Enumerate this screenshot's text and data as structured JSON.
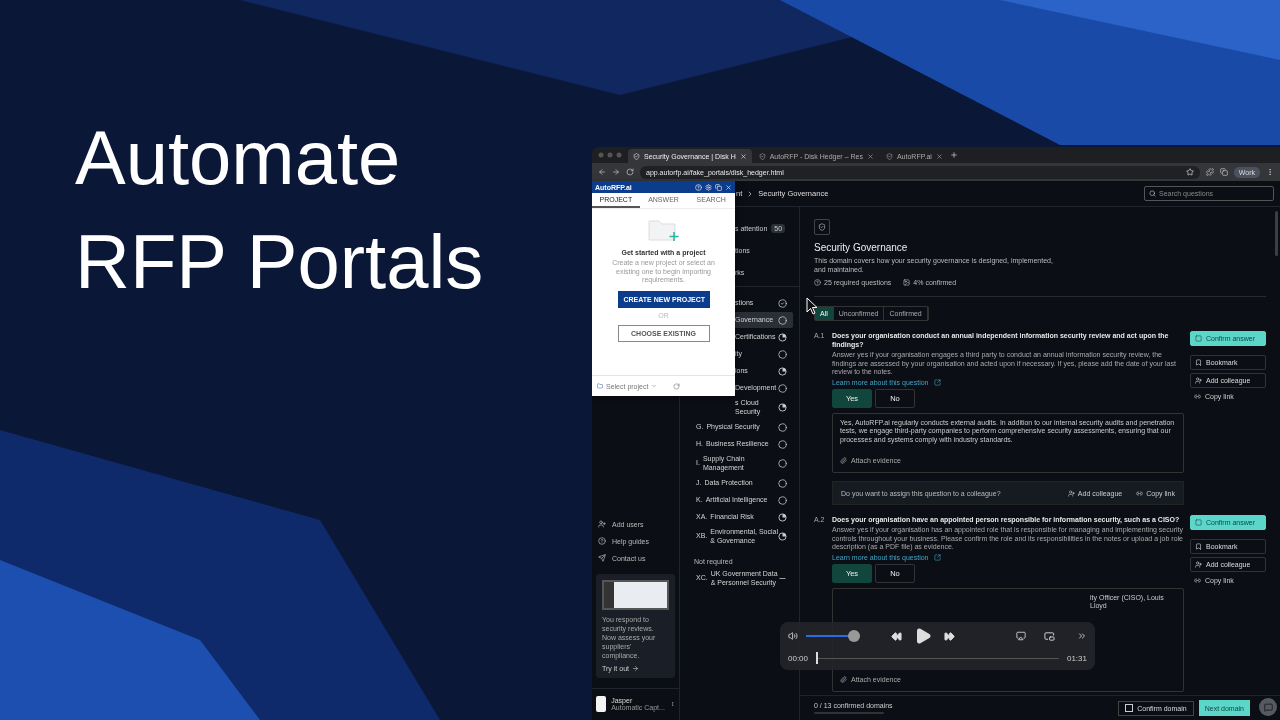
{
  "headline": "Automate RFP Portals",
  "browser": {
    "tabs": [
      {
        "title": "Security Governance | Disk H",
        "selected": true
      },
      {
        "title": "AutoRFP - Disk Hedger – Res",
        "selected": false
      },
      {
        "title": "AutoRFP.ai",
        "selected": false
      }
    ],
    "url": "app.autorfp.ai/fake_portals/disk_hedger.html",
    "profile": "Work"
  },
  "header": {
    "breadcrumb": [
      "nt",
      "Security Governance"
    ],
    "search_placeholder": "Search questions"
  },
  "sidebar": {
    "links": [
      "Add users",
      "Help guides",
      "Contact us"
    ],
    "promo": {
      "text": "You respond to security reviews. Now assess your suppliers' compliance.",
      "link": "Try it out"
    },
    "user": {
      "name": "Jasper",
      "org": "Automatic Capt..."
    }
  },
  "nav": {
    "items": [
      {
        "label": "s attention",
        "badge": "50",
        "covered": true
      },
      {
        "label": "tions",
        "covered": true
      },
      {
        "label": "rks",
        "covered": true
      }
    ],
    "domains": [
      {
        "name": "stions",
        "kind": "done",
        "selected": false,
        "covered": true
      },
      {
        "name": "Governance",
        "kind": "empty",
        "selected": true,
        "covered": true
      },
      {
        "name": "Certifications",
        "kind": "partial",
        "selected": false,
        "covered": true
      },
      {
        "name": "ity",
        "kind": "empty",
        "selected": false,
        "covered": true
      },
      {
        "name": "ions",
        "kind": "partial",
        "selected": false,
        "covered": true
      },
      {
        "name": "Development",
        "kind": "empty",
        "selected": false,
        "covered": true
      },
      {
        "name": "s Cloud Security",
        "kind": "partial",
        "selected": false,
        "covered": true
      },
      {
        "code": "G.",
        "name": "Physical Security",
        "kind": "empty",
        "selected": false
      },
      {
        "code": "H.",
        "name": "Business Resilience",
        "kind": "empty",
        "selected": false
      },
      {
        "code": "I.",
        "name": "Supply Chain Management",
        "kind": "empty",
        "selected": false
      },
      {
        "code": "J.",
        "name": "Data Protection",
        "kind": "empty",
        "selected": false
      },
      {
        "code": "K.",
        "name": "Artificial Intelligence",
        "kind": "empty",
        "selected": false
      },
      {
        "code": "XA.",
        "name": "Financial Risk",
        "kind": "partial",
        "selected": false
      },
      {
        "code": "XB.",
        "name": "Environmental, Social & Governance",
        "kind": "partial",
        "selected": false
      }
    ],
    "not_required_label": "Not required",
    "not_required": [
      {
        "code": "XC.",
        "name": "UK Government Data & Personnel Security",
        "kind": "none",
        "selected": false
      }
    ]
  },
  "popup": {
    "brand": "AutoRFP.ai",
    "tabs": [
      {
        "label": "PROJECT",
        "selected": true
      },
      {
        "label": "ANSWER",
        "selected": false
      },
      {
        "label": "SEARCH",
        "selected": false
      }
    ],
    "heading": "Get started with a project",
    "text": "Create a new project or select an existing one to begin importing requirements.",
    "primary": "CREATE NEW PROJECT",
    "or": "OR",
    "secondary": "CHOOSE EXISTING",
    "select": "Select project"
  },
  "domain": {
    "title": "Security Governance",
    "description": "This domain covers how your security governance is designed, implemented, and maintained.",
    "stats": [
      "25 required questions",
      "4% confirmed"
    ],
    "filters": [
      {
        "label": "All",
        "selected": true
      },
      {
        "label": "Unconfirmed",
        "selected": false
      },
      {
        "label": "Confirmed",
        "selected": false
      }
    ]
  },
  "questions": [
    {
      "number": "A.1",
      "title": "Does your organisation conduct an annual independent information security review and act upon the findings?",
      "help": "Answer yes if your organisation engages a third party to conduct an annual information security review, the findings are assessed by your organisation and acted upon if necessary. If yes, please add the date of your last review to the notes.",
      "link": "Learn more about this question",
      "options": [
        {
          "label": "Yes",
          "selected": true
        },
        {
          "label": "No",
          "selected": false
        }
      ],
      "answer": "Yes, AutoRFP.ai regularly conducts external audits. In addition to our internal security audits and penetration tests, we engage third-party companies to perform comprehensive security assessments, ensuring that our processes and systems comply with industry standards.",
      "answer_covered": false,
      "attach": "Attach evidence",
      "actions": [
        "Confirm answer",
        "Bookmark",
        "Add colleague",
        "Copy link"
      ],
      "assign": {
        "text": "Do you want to assign this question to a colleague?",
        "add": "Add colleague",
        "copy": "Copy link"
      }
    },
    {
      "number": "A.2",
      "title": "Does your organisation have an appointed person responsible for information security, such as a CISO?",
      "help": "Answer yes if your organisation has an appointed role that is responsible for managing and implementing security controls throughout your business. Please confirm the role and its responsibilities in the notes or upload a job role description (as a PDF file) as evidence.",
      "link": "Learn more about this question",
      "options": [
        {
          "label": "Yes",
          "selected": true
        },
        {
          "label": "No",
          "selected": false
        }
      ],
      "answer": "ity Officer (CISO), Louis Lloyd",
      "answer_covered": true,
      "attach": "Attach evidence",
      "actions": [
        "Confirm answer",
        "Bookmark",
        "Add colleague",
        "Copy link"
      ]
    }
  ],
  "footer": {
    "progress": "0 / 13 confirmed domains",
    "level": 0,
    "confirm": {
      "label": "Confirm domain",
      "checked": false
    },
    "next": "Next domain"
  },
  "player": {
    "volume": {
      "level": 1
    },
    "elapsed": "00:00",
    "duration": "01:31",
    "progress": {
      "level": 0
    }
  }
}
